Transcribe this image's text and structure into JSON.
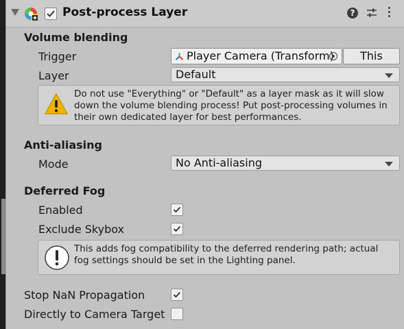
{
  "header": {
    "title": "Post-process Layer",
    "enabled": true,
    "help_icon": "help-icon",
    "presets_icon": "presets-icon",
    "menu_icon": "kebab-menu-icon"
  },
  "volume_blending": {
    "section_label": "Volume blending",
    "trigger": {
      "label": "Trigger",
      "value": "Player Camera (Transform)",
      "this_button": "This"
    },
    "layer": {
      "label": "Layer",
      "value": "Default"
    },
    "warning": "Do not use \"Everything\" or \"Default\" as a layer mask as it will slow down the volume blending process! Put post-processing volumes in their own dedicated layer for best performances."
  },
  "anti_aliasing": {
    "section_label": "Anti-aliasing",
    "mode": {
      "label": "Mode",
      "value": "No Anti-aliasing"
    }
  },
  "deferred_fog": {
    "section_label": "Deferred Fog",
    "enabled": {
      "label": "Enabled",
      "checked": true
    },
    "exclude_skybox": {
      "label": "Exclude Skybox",
      "checked": true
    },
    "info": "This adds fog compatibility to the deferred rendering path; actual fog settings should be set in the Lighting panel."
  },
  "stop_nan": {
    "label": "Stop NaN Propagation",
    "checked": true
  },
  "direct_to_camera": {
    "label": "Directly to Camera Target",
    "checked": false
  },
  "colors": {
    "panel_bg": "#c2c2c2",
    "warning_yellow": "#f0b400",
    "field_bg": "#e4e4e4"
  }
}
